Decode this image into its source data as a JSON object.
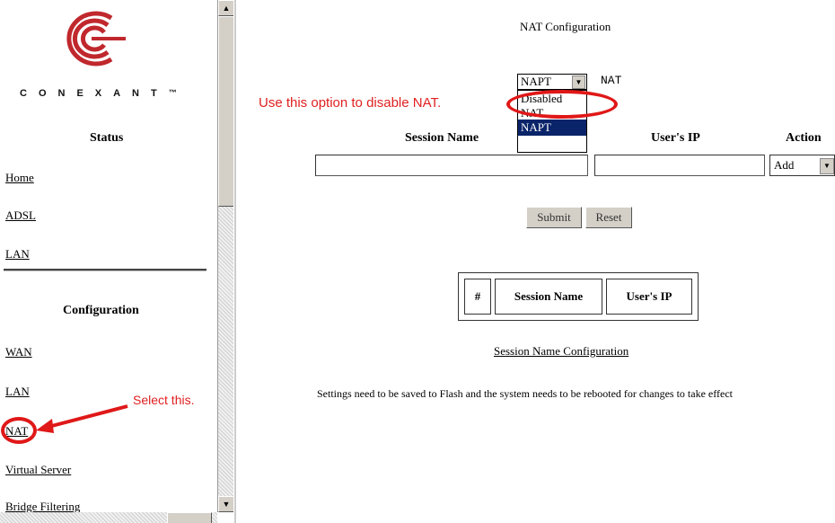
{
  "sidebar": {
    "brand": "CONEXANT",
    "tm": "™",
    "status_title": "Status",
    "status_links": [
      "Home",
      "ADSL",
      "LAN"
    ],
    "config_title": "Configuration",
    "config_links": [
      "WAN",
      "LAN",
      "NAT",
      "Virtual Server",
      "Bridge Filtering"
    ]
  },
  "main": {
    "title": "NAT Configuration",
    "nat_mode": {
      "selected": "NAPT",
      "label": "NAT",
      "options": [
        "Disabled",
        "NAT",
        "NAPT"
      ],
      "highlighted": "NAPT"
    },
    "table_headers": {
      "session_name": "Session Name",
      "users_ip": "User's IP",
      "action": "Action"
    },
    "session_name_value": "",
    "users_ip_value": "",
    "action": {
      "selected": "Add"
    },
    "buttons": {
      "submit": "Submit",
      "reset": "Reset"
    },
    "session_table": {
      "col_num": "#",
      "col_name": "Session Name",
      "col_ip": "User's IP"
    },
    "session_caption": "Session Name Configuration",
    "note": "Settings need to be saved to Flash and the system needs to be rebooted for changes to take effect"
  },
  "annotations": {
    "disable_hint": "Use this option to disable NAT.",
    "select_hint": "Select this."
  },
  "colors": {
    "annotation": "#e02020",
    "highlight": "#0a246a"
  },
  "icons": {
    "scroll_up": "scroll-up-arrow-icon",
    "scroll_down": "scroll-down-arrow-icon",
    "dropdown": "dropdown-arrow-icon"
  }
}
